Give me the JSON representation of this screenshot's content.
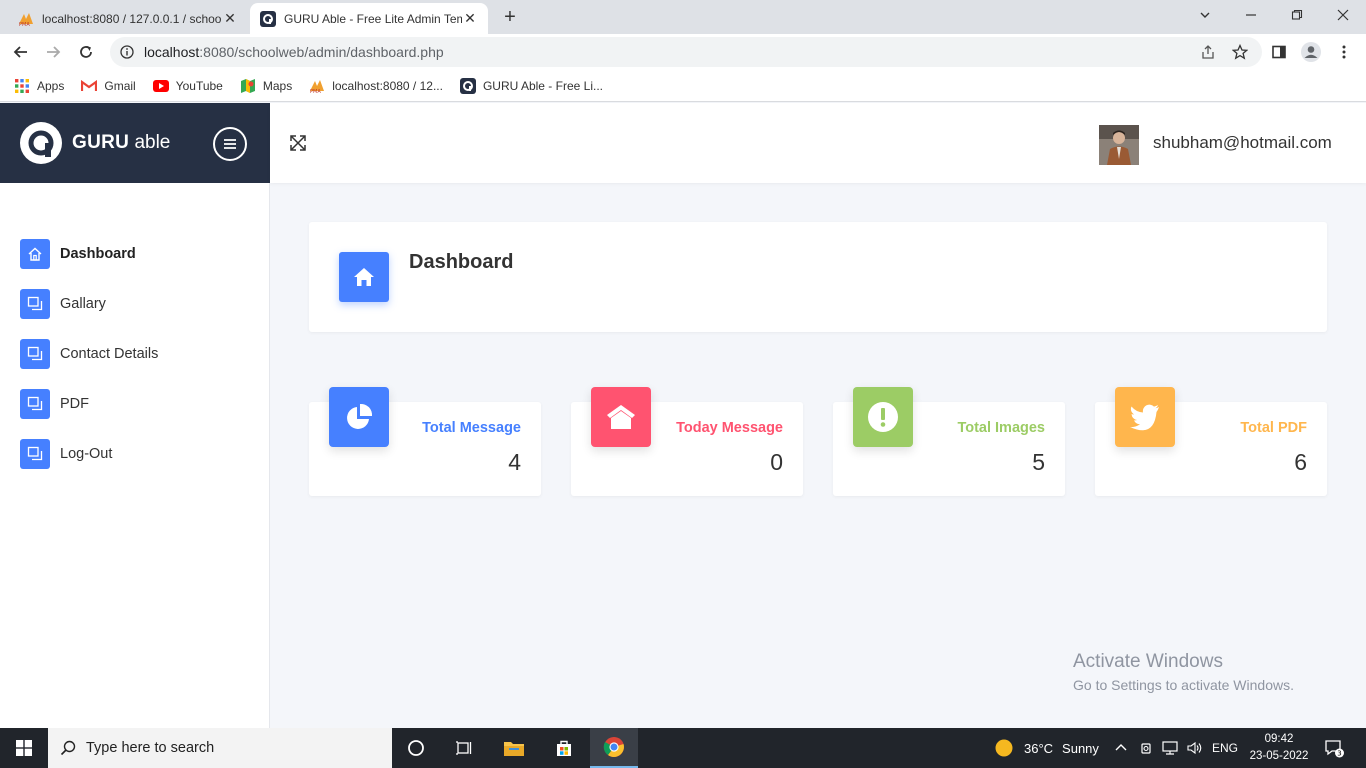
{
  "browser": {
    "tabs": [
      {
        "title": "localhost:8080 / 127.0.0.1 / schoo",
        "active": false
      },
      {
        "title": "GURU Able - Free Lite Admin Tem",
        "active": true
      }
    ],
    "new_tab": "+",
    "url_host": "localhost",
    "url_path": ":8080/schoolweb/admin/dashboard.php",
    "bookmarks": [
      {
        "label": "Apps",
        "icon": "apps-grid-icon"
      },
      {
        "label": "Gmail",
        "icon": "gmail-icon"
      },
      {
        "label": "YouTube",
        "icon": "youtube-icon"
      },
      {
        "label": "Maps",
        "icon": "maps-icon"
      },
      {
        "label": "localhost:8080 / 12...",
        "icon": "phpmyadmin-icon"
      },
      {
        "label": "GURU Able - Free Li...",
        "icon": "guru-able-icon"
      }
    ]
  },
  "app": {
    "brand_bold": "GURU",
    "brand_light": "able",
    "user_email": "shubham@hotmail.com",
    "sidebar": [
      {
        "label": "Dashboard",
        "active": true,
        "icon": "home-icon"
      },
      {
        "label": "Gallary",
        "active": false,
        "icon": "gallery-icon"
      },
      {
        "label": "Contact Details",
        "active": false,
        "icon": "contact-icon"
      },
      {
        "label": "PDF",
        "active": false,
        "icon": "pdf-icon"
      },
      {
        "label": "Log-Out",
        "active": false,
        "icon": "logout-icon"
      }
    ],
    "page_title": "Dashboard",
    "stats": [
      {
        "label": "Total Message",
        "value": "4",
        "color": "#4680ff",
        "icon": "pie-chart-icon"
      },
      {
        "label": "Today Message",
        "value": "0",
        "color": "#ff5370",
        "icon": "home-icon"
      },
      {
        "label": "Total Images",
        "value": "5",
        "color": "#9ccc65",
        "icon": "alert-icon"
      },
      {
        "label": "Total PDF",
        "value": "6",
        "color": "#ffb64d",
        "icon": "twitter-icon"
      }
    ]
  },
  "watermark": {
    "line1": "Activate Windows",
    "line2": "Go to Settings to activate Windows."
  },
  "taskbar": {
    "search_placeholder": "Type here to search",
    "weather_temp": "36°C",
    "weather_text": "Sunny",
    "language": "ENG",
    "time": "09:42",
    "date": "23-05-2022",
    "notification_count": "3"
  }
}
